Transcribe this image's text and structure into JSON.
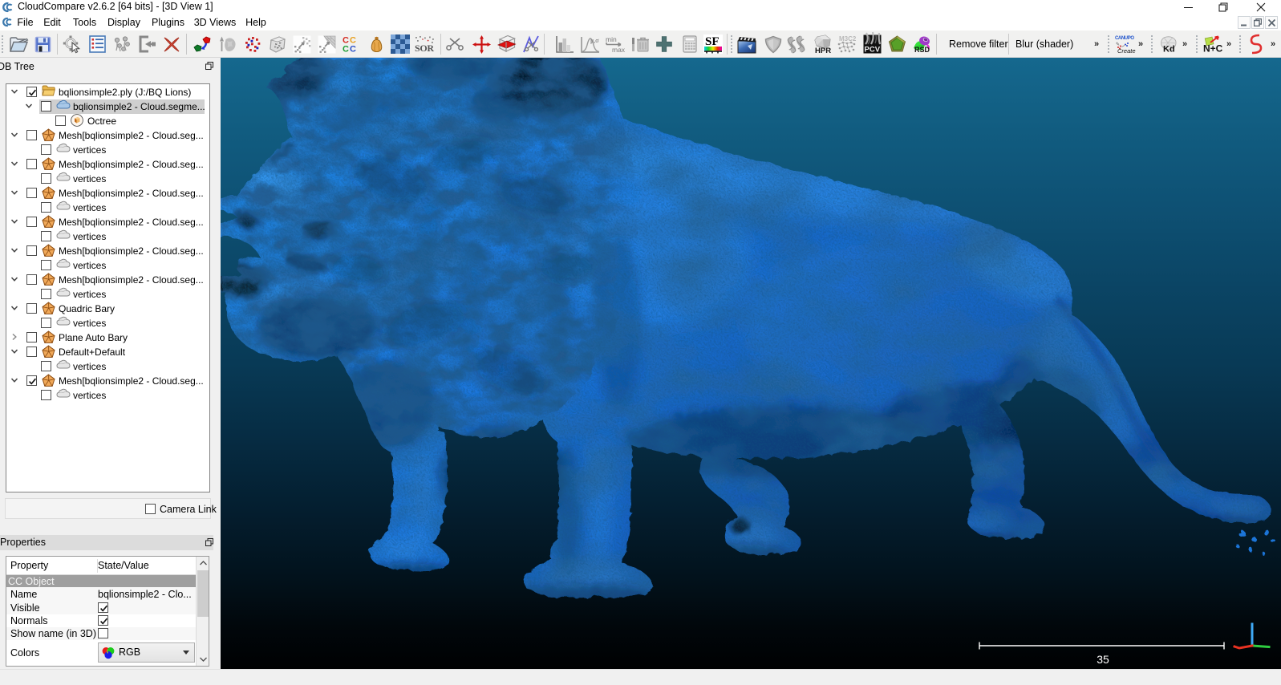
{
  "window": {
    "title": "CloudCompare v2.6.2 [64 bits] - [3D View 1]",
    "controls": [
      "minimize",
      "restore",
      "close"
    ]
  },
  "menubar": {
    "items": [
      "File",
      "Edit",
      "Tools",
      "Display",
      "Plugins",
      "3D Views",
      "Help"
    ],
    "mdi_controls": [
      "minimize",
      "restore",
      "close"
    ]
  },
  "toolbar": {
    "buttons": [
      "open-file",
      "save",
      "pick-rotation-center",
      "toggle-properties-list",
      "point-list-picking",
      "apply-transformation",
      "delete-entity",
      "register-entities",
      "align-entities",
      "subsample-cloud",
      "compute-octree",
      "cloud-cloud-distance",
      "cloud-mesh-distance",
      "cc-icons",
      "merge-clouds",
      "interpolate-colors",
      "sor-filter",
      "cross-section-scissors",
      "translate-rotate",
      "cross-section-box",
      "segment",
      "show-histogram",
      "gaussian-filter",
      "filter-by-value",
      "delete-scalar-field",
      "add-constant-sf",
      "sf-arithmetic",
      "convert-sf-to-color",
      "animation",
      "shield-qssao",
      "ss-curvature",
      "hpr",
      "m3c2",
      "pcv",
      "poisson-reconstruction",
      "rsd"
    ],
    "remove_filter_label": "Remove filter",
    "blur_shader_label": "Blur (shader)",
    "chevron": "»",
    "plugin_badges": {
      "canupo": "Create",
      "kd": "Kd",
      "nc": "N+C",
      "s": "S"
    }
  },
  "db_tree": {
    "title": "DB Tree",
    "camera_link_label": "Camera Link",
    "camera_link_checked": false,
    "rows": [
      {
        "level": 0,
        "chevron": "down",
        "checked": true,
        "icon": "folder",
        "label": "bqlionsimple2.ply (J:/BQ Lions)",
        "selected": false
      },
      {
        "level": 1,
        "chevron": "down",
        "checked": false,
        "icon": "cloud-blue",
        "label": "bqlionsimple2 - Cloud.segme...",
        "selected": true
      },
      {
        "level": 2,
        "chevron": "none",
        "checked": false,
        "icon": "octree",
        "label": "Octree",
        "selected": false
      },
      {
        "level": 0,
        "chevron": "down",
        "checked": false,
        "icon": "mesh",
        "label": "Mesh[bqlionsimple2 - Cloud.seg...",
        "selected": false
      },
      {
        "level": 1,
        "chevron": "none",
        "checked": false,
        "icon": "cloud-gray",
        "label": "vertices",
        "selected": false
      },
      {
        "level": 0,
        "chevron": "down",
        "checked": false,
        "icon": "mesh",
        "label": "Mesh[bqlionsimple2 - Cloud.seg...",
        "selected": false
      },
      {
        "level": 1,
        "chevron": "none",
        "checked": false,
        "icon": "cloud-gray",
        "label": "vertices",
        "selected": false
      },
      {
        "level": 0,
        "chevron": "down",
        "checked": false,
        "icon": "mesh",
        "label": "Mesh[bqlionsimple2 - Cloud.seg...",
        "selected": false
      },
      {
        "level": 1,
        "chevron": "none",
        "checked": false,
        "icon": "cloud-gray",
        "label": "vertices",
        "selected": false
      },
      {
        "level": 0,
        "chevron": "down",
        "checked": false,
        "icon": "mesh",
        "label": "Mesh[bqlionsimple2 - Cloud.seg...",
        "selected": false
      },
      {
        "level": 1,
        "chevron": "none",
        "checked": false,
        "icon": "cloud-gray",
        "label": "vertices",
        "selected": false
      },
      {
        "level": 0,
        "chevron": "down",
        "checked": false,
        "icon": "mesh",
        "label": "Mesh[bqlionsimple2 - Cloud.seg...",
        "selected": false
      },
      {
        "level": 1,
        "chevron": "none",
        "checked": false,
        "icon": "cloud-gray",
        "label": "vertices",
        "selected": false
      },
      {
        "level": 0,
        "chevron": "down",
        "checked": false,
        "icon": "mesh",
        "label": "Mesh[bqlionsimple2 - Cloud.seg...",
        "selected": false
      },
      {
        "level": 1,
        "chevron": "none",
        "checked": false,
        "icon": "cloud-gray",
        "label": "vertices",
        "selected": false
      },
      {
        "level": 0,
        "chevron": "down",
        "checked": false,
        "icon": "mesh",
        "label": "Quadric Bary",
        "selected": false
      },
      {
        "level": 1,
        "chevron": "none",
        "checked": false,
        "icon": "cloud-gray",
        "label": "vertices",
        "selected": false
      },
      {
        "level": 0,
        "chevron": "right",
        "checked": false,
        "icon": "mesh",
        "label": "Plane Auto Bary",
        "selected": false
      },
      {
        "level": 0,
        "chevron": "down",
        "checked": false,
        "icon": "mesh",
        "label": "Default+Default",
        "selected": false
      },
      {
        "level": 1,
        "chevron": "none",
        "checked": false,
        "icon": "cloud-gray",
        "label": "vertices",
        "selected": false
      },
      {
        "level": 0,
        "chevron": "down",
        "checked": true,
        "icon": "mesh",
        "label": "Mesh[bqlionsimple2 - Cloud.seg...",
        "selected": false
      },
      {
        "level": 1,
        "chevron": "none",
        "checked": false,
        "icon": "cloud-gray",
        "label": "vertices",
        "selected": false
      }
    ]
  },
  "properties": {
    "title": "Properties",
    "columns": [
      "Property",
      "State/Value"
    ],
    "rows": [
      {
        "type": "section",
        "label": "CC Object"
      },
      {
        "type": "text",
        "label": "Name",
        "value": "bqlionsimple2 - Clo..."
      },
      {
        "type": "checkbox",
        "label": "Visible",
        "checked": true
      },
      {
        "type": "checkbox",
        "label": "Normals",
        "checked": true
      },
      {
        "type": "checkbox",
        "label": "Show name (in 3D)",
        "checked": false
      },
      {
        "type": "combo",
        "label": "Colors",
        "value": "RGB"
      }
    ]
  },
  "viewport": {
    "scale_label": "35",
    "axis_colors": {
      "x": "#e83222",
      "y": "#2ecc40",
      "z": "#3fa9f5"
    },
    "object": "blue 3D scanned lion statue mesh"
  }
}
